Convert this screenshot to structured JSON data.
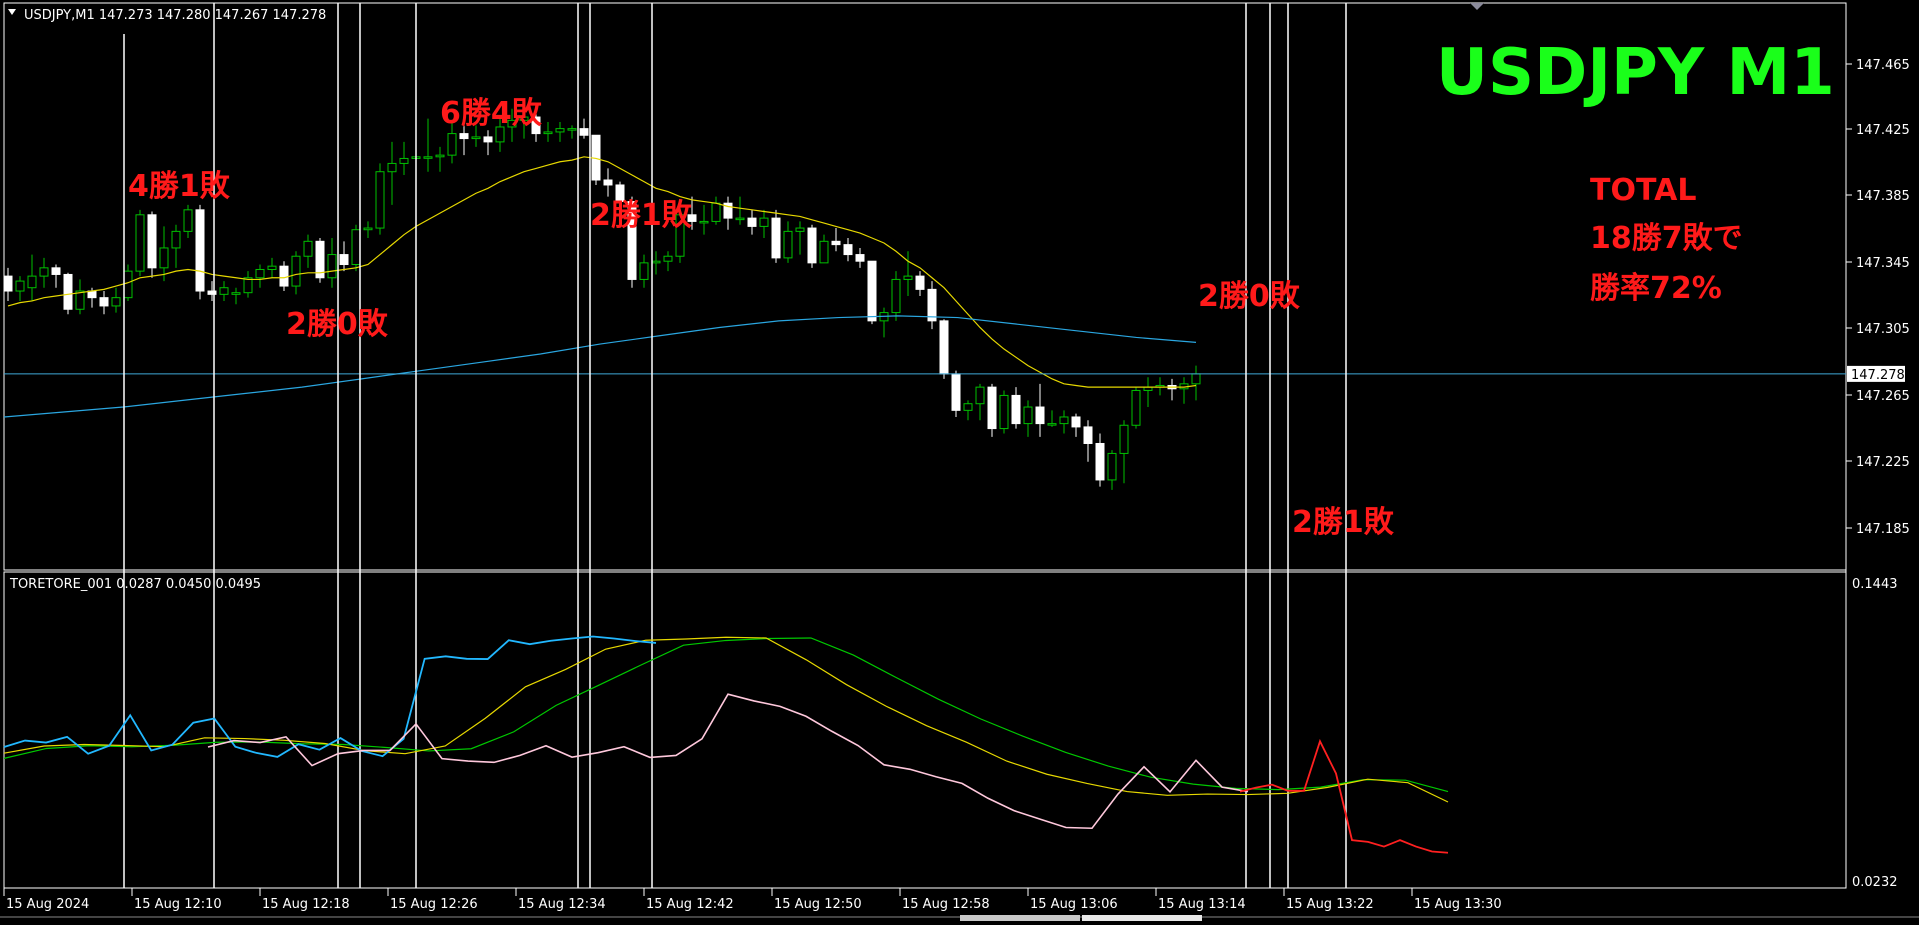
{
  "chart_header": "USDJPY,M1  147.273 147.280 147.267 147.278",
  "indicator_header": "TORETORE_001 0.0287 0.0450 0.0495",
  "title_overlay": "USDJPY  M1",
  "total_box": {
    "line1": "TOTAL",
    "line2": "18勝7敗で",
    "line3": "勝率72%"
  },
  "annotations": [
    "4勝1敗",
    "2勝0敗",
    "6勝4敗",
    "2勝1敗",
    "2勝0敗",
    "2勝1敗"
  ],
  "price_axis": {
    "ticks": [
      "147.465",
      "147.425",
      "147.385",
      "147.345",
      "147.305",
      "147.265",
      "147.225",
      "147.185"
    ],
    "current_price": "147.278"
  },
  "indicator_axis": {
    "ticks": [
      "0.1443",
      "0.0232"
    ]
  },
  "time_axis": {
    "ticks": [
      "15 Aug 2024",
      "15 Aug 12:10",
      "15 Aug 12:18",
      "15 Aug 12:26",
      "15 Aug 12:34",
      "15 Aug 12:42",
      "15 Aug 12:50",
      "15 Aug 12:58",
      "15 Aug 13:06",
      "15 Aug 13:14",
      "15 Aug 13:22",
      "15 Aug 13:30"
    ]
  },
  "colors": {
    "bull_candle": "#00c000",
    "bear_candle": "#ffffff",
    "ma_fast": "#e6d800",
    "ma_slow": "#2aa6e0",
    "current_price_line": "#3fa9d8",
    "ind_blue": "#22b8ff",
    "ind_pink": "#ffc8dc",
    "ind_red": "#ff2020",
    "ind_yellow": "#e6d800",
    "ind_green": "#00c800",
    "annotation": "#ff1a1a",
    "title": "#1aff1a"
  },
  "chart_data": {
    "type": "candlestick",
    "symbol": "USDJPY",
    "timeframe": "M1",
    "ylim": [
      147.165,
      147.478
    ],
    "indicator_ylim": [
      0.0232,
      0.1443
    ],
    "candles": [
      [
        147.337,
        147.342,
        147.322,
        147.328
      ],
      [
        147.328,
        147.337,
        147.322,
        147.334
      ],
      [
        147.33,
        147.35,
        147.322,
        147.337
      ],
      [
        147.337,
        147.348,
        147.33,
        147.342
      ],
      [
        147.342,
        147.344,
        147.33,
        147.338
      ],
      [
        147.338,
        147.339,
        147.314,
        147.317
      ],
      [
        147.317,
        147.335,
        147.314,
        147.328
      ],
      [
        147.328,
        147.33,
        147.318,
        147.324
      ],
      [
        147.324,
        147.328,
        147.314,
        147.319
      ],
      [
        147.319,
        147.33,
        147.315,
        147.324
      ],
      [
        147.324,
        147.344,
        147.322,
        147.34
      ],
      [
        147.34,
        147.377,
        147.337,
        147.374
      ],
      [
        147.374,
        147.376,
        147.336,
        147.342
      ],
      [
        147.342,
        147.367,
        147.334,
        147.354
      ],
      [
        147.354,
        147.368,
        147.342,
        147.364
      ],
      [
        147.364,
        147.38,
        147.36,
        147.377
      ],
      [
        147.377,
        147.38,
        147.323,
        147.328
      ],
      [
        147.328,
        147.334,
        147.322,
        147.326
      ],
      [
        147.326,
        147.334,
        147.322,
        147.33
      ],
      [
        147.326,
        147.33,
        147.32,
        147.327
      ],
      [
        147.327,
        147.34,
        147.324,
        147.336
      ],
      [
        147.336,
        147.344,
        147.33,
        147.341
      ],
      [
        147.341,
        147.348,
        147.336,
        147.343
      ],
      [
        147.343,
        147.346,
        147.328,
        147.331
      ],
      [
        147.331,
        147.352,
        147.326,
        147.349
      ],
      [
        147.349,
        147.362,
        147.342,
        147.358
      ],
      [
        147.358,
        147.36,
        147.333,
        147.336
      ],
      [
        147.336,
        147.36,
        147.33,
        147.35
      ],
      [
        147.35,
        147.358,
        147.34,
        147.344
      ],
      [
        147.344,
        147.368,
        147.34,
        147.365
      ],
      [
        147.365,
        147.37,
        147.36,
        147.366
      ],
      [
        147.366,
        147.405,
        147.362,
        147.4
      ],
      [
        147.4,
        147.418,
        147.38,
        147.405
      ],
      [
        147.405,
        147.418,
        147.398,
        147.408
      ],
      [
        147.408,
        147.413,
        147.392,
        147.409
      ],
      [
        147.409,
        147.432,
        147.4,
        147.409
      ],
      [
        147.409,
        147.415,
        147.4,
        147.41
      ],
      [
        147.41,
        147.43,
        147.405,
        147.423
      ],
      [
        147.423,
        147.438,
        147.41,
        147.42
      ],
      [
        147.42,
        147.428,
        147.415,
        147.421
      ],
      [
        147.421,
        147.425,
        147.41,
        147.418
      ],
      [
        147.418,
        147.433,
        147.412,
        147.427
      ],
      [
        147.427,
        147.438,
        147.418,
        147.431
      ],
      [
        147.431,
        147.442,
        147.42,
        147.433
      ],
      [
        147.433,
        147.437,
        147.418,
        147.423
      ],
      [
        147.423,
        147.43,
        147.418,
        147.424
      ],
      [
        147.424,
        147.43,
        147.418,
        147.426
      ],
      [
        147.426,
        147.428,
        147.42,
        147.426
      ],
      [
        147.426,
        147.432,
        147.42,
        147.422
      ],
      [
        147.422,
        147.422,
        147.392,
        147.395
      ],
      [
        147.395,
        147.402,
        147.385,
        147.392
      ],
      [
        147.392,
        147.394,
        147.378,
        147.382
      ],
      [
        147.382,
        147.385,
        147.33,
        147.335
      ],
      [
        147.335,
        147.35,
        147.33,
        147.345
      ],
      [
        147.345,
        147.352,
        147.338,
        147.346
      ],
      [
        147.346,
        147.352,
        147.34,
        147.349
      ],
      [
        147.349,
        147.378,
        147.345,
        147.374
      ],
      [
        147.374,
        147.385,
        147.365,
        147.37
      ],
      [
        147.37,
        147.38,
        147.362,
        147.37
      ],
      [
        147.37,
        147.385,
        147.368,
        147.381
      ],
      [
        147.381,
        147.385,
        147.365,
        147.372
      ],
      [
        147.372,
        147.385,
        147.368,
        147.372
      ],
      [
        147.372,
        147.377,
        147.362,
        147.367
      ],
      [
        147.367,
        147.377,
        147.36,
        147.372
      ],
      [
        147.372,
        147.377,
        147.345,
        147.348
      ],
      [
        147.348,
        147.37,
        147.345,
        147.364
      ],
      [
        147.364,
        147.37,
        147.35,
        147.366
      ],
      [
        147.366,
        147.368,
        147.342,
        147.345
      ],
      [
        147.345,
        147.362,
        147.345,
        147.358
      ],
      [
        147.358,
        147.366,
        147.352,
        147.356
      ],
      [
        147.356,
        147.36,
        147.346,
        147.35
      ],
      [
        147.35,
        147.354,
        147.342,
        147.346
      ],
      [
        147.346,
        147.346,
        147.308,
        147.31
      ],
      [
        147.31,
        147.318,
        147.3,
        147.315
      ],
      [
        147.315,
        147.34,
        147.31,
        147.335
      ],
      [
        147.335,
        147.352,
        147.325,
        147.337
      ],
      [
        147.337,
        147.34,
        147.325,
        147.329
      ],
      [
        147.329,
        147.334,
        147.305,
        147.31
      ],
      [
        147.31,
        147.311,
        147.275,
        147.278
      ],
      [
        147.278,
        147.28,
        147.252,
        147.256
      ],
      [
        147.256,
        147.262,
        147.25,
        147.26
      ],
      [
        147.26,
        147.272,
        147.25,
        147.27
      ],
      [
        147.27,
        147.272,
        147.24,
        147.245
      ],
      [
        147.245,
        147.268,
        147.242,
        147.265
      ],
      [
        147.265,
        147.27,
        147.245,
        147.248
      ],
      [
        147.248,
        147.262,
        147.24,
        147.258
      ],
      [
        147.258,
        147.272,
        147.24,
        147.248
      ],
      [
        147.248,
        147.256,
        147.246,
        147.248
      ],
      [
        147.248,
        147.256,
        147.242,
        147.252
      ],
      [
        147.252,
        147.254,
        147.24,
        147.246
      ],
      [
        147.246,
        147.25,
        147.225,
        147.236
      ],
      [
        147.236,
        147.242,
        147.21,
        147.214
      ],
      [
        147.214,
        147.232,
        147.208,
        147.23
      ],
      [
        147.23,
        147.25,
        147.212,
        147.247
      ],
      [
        147.247,
        147.27,
        147.245,
        147.268
      ],
      [
        147.268,
        147.276,
        147.258,
        147.27
      ],
      [
        147.27,
        147.276,
        147.265,
        147.271
      ],
      [
        147.271,
        147.275,
        147.262,
        147.269
      ],
      [
        147.269,
        147.276,
        147.26,
        147.272
      ],
      [
        147.272,
        147.283,
        147.262,
        147.278
      ]
    ],
    "ma_fast": [
      147.319,
      147.321,
      147.322,
      147.324,
      147.325,
      147.326,
      147.327,
      147.328,
      147.329,
      147.331,
      147.333,
      147.336,
      147.337,
      147.338,
      147.34,
      147.341,
      147.34,
      147.338,
      147.337,
      147.336,
      147.335,
      147.335,
      147.336,
      147.336,
      147.338,
      147.339,
      147.339,
      147.34,
      147.341,
      147.342,
      147.344,
      147.35,
      147.356,
      147.362,
      147.367,
      147.371,
      147.375,
      147.379,
      147.383,
      147.387,
      147.39,
      147.394,
      147.397,
      147.4,
      147.402,
      147.404,
      147.406,
      147.407,
      147.409,
      147.408,
      147.406,
      147.402,
      147.398,
      147.394,
      147.39,
      147.388,
      147.385,
      147.383,
      147.382,
      147.381,
      147.379,
      147.378,
      147.377,
      147.376,
      147.375,
      147.374,
      147.373,
      147.371,
      147.369,
      147.367,
      147.365,
      147.363,
      147.36,
      147.357,
      147.352,
      147.346,
      147.342,
      147.336,
      147.33,
      147.322,
      147.314,
      147.306,
      147.299,
      147.293,
      147.288,
      147.283,
      147.279,
      147.275,
      147.272,
      147.271,
      147.27,
      147.27,
      147.27,
      147.27,
      147.27,
      147.27,
      147.27,
      147.27,
      147.27,
      147.271
    ],
    "ma_slow": [
      147.252,
      147.255,
      147.258,
      147.262,
      147.266,
      147.27,
      147.275,
      147.28,
      147.285,
      147.29,
      147.296,
      147.301,
      147.306,
      147.31,
      147.312,
      147.313,
      147.312,
      147.308,
      147.304,
      147.3,
      147.297
    ],
    "indicator": {
      "blue": [
        0.0777,
        0.0803,
        0.0795,
        0.0818,
        0.075,
        0.0782,
        0.0905,
        0.0763,
        0.0786,
        0.0875,
        0.0892,
        0.0778,
        0.0753,
        0.0737,
        0.0788,
        0.0766,
        0.0813,
        0.0761,
        0.074,
        0.081,
        0.1133,
        0.1143,
        0.1133,
        0.1132,
        0.1208,
        0.1192,
        0.1206,
        0.1215,
        0.1223,
        0.1215,
        0.1205,
        0.1197
      ],
      "pink": [
        0.0777,
        0.0803,
        0.0795,
        0.0818,
        0.0702,
        0.075,
        0.0763,
        0.0763,
        0.087,
        0.073,
        0.072,
        0.0715,
        0.0743,
        0.0782,
        0.0736,
        0.0754,
        0.0778,
        0.0735,
        0.0743,
        0.081,
        0.099,
        0.0963,
        0.0941,
        0.0901,
        0.084,
        0.0783,
        0.0705,
        0.0687,
        0.0657,
        0.063,
        0.057,
        0.052,
        0.0486,
        0.0452,
        0.0449,
        0.0587,
        0.0697,
        0.0596,
        0.0723,
        0.0615,
        0.0597
      ],
      "red": [
        0.0597,
        0.0613,
        0.0625,
        0.06,
        0.06,
        0.08,
        0.067,
        0.0401,
        0.0394,
        0.0375,
        0.0401,
        0.0375,
        0.0355,
        0.035
      ],
      "yellow": [
        0.0752,
        0.0781,
        0.0787,
        0.0783,
        0.0778,
        0.0814,
        0.0811,
        0.0804,
        0.0791,
        0.0762,
        0.075,
        0.0781,
        0.0893,
        0.102,
        0.109,
        0.1172,
        0.1208,
        0.1213,
        0.122,
        0.1217,
        0.1129,
        0.1029,
        0.0941,
        0.0863,
        0.0796,
        0.072,
        0.0667,
        0.063,
        0.0597,
        0.0582,
        0.0587,
        0.0585,
        0.059,
        0.0614,
        0.0647,
        0.0633,
        0.0555
      ],
      "green": [
        0.0731,
        0.0771,
        0.0782,
        0.0778,
        0.0784,
        0.0796,
        0.0797,
        0.079,
        0.0787,
        0.0775,
        0.0761,
        0.077,
        0.0838,
        0.0945,
        0.1026,
        0.1108,
        0.1188,
        0.1207,
        0.1215,
        0.1217,
        0.1148,
        0.1058,
        0.097,
        0.089,
        0.082,
        0.0755,
        0.07,
        0.0655,
        0.0627,
        0.061,
        0.0605,
        0.0615,
        0.0645,
        0.0643,
        0.0597
      ]
    }
  }
}
